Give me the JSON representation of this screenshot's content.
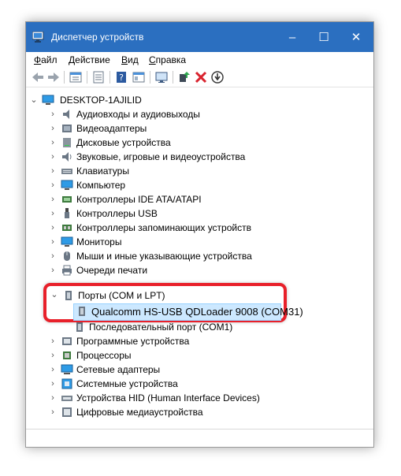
{
  "window": {
    "title": "Диспетчер устройств",
    "controls": {
      "minimize": "–",
      "maximize": "☐",
      "close": "✕"
    },
    "accent": "#2b6fc0"
  },
  "menu": [
    {
      "label": "Файл",
      "mnemonic": "Ф",
      "rest": "айл"
    },
    {
      "label": "Действие",
      "mnemonic": "Д",
      "rest": "ействие"
    },
    {
      "label": "Вид",
      "mnemonic": "В",
      "rest": "ид"
    },
    {
      "label": "Справка",
      "mnemonic": "С",
      "rest": "правка"
    }
  ],
  "toolbar": [
    "back-icon",
    "forward-icon",
    "properties-list-icon",
    "properties-icon",
    "help-icon",
    "view-icon",
    "monitor-scan-icon",
    "update-driver-icon",
    "uninstall-icon",
    "download-icon"
  ],
  "tree": {
    "root": "DESKTOP-1AJILID",
    "items": [
      {
        "label": "Аудиовходы и аудиовыходы",
        "icon": "audio-icon"
      },
      {
        "label": "Видеоадаптеры",
        "icon": "display-adapter-icon"
      },
      {
        "label": "Дисковые устройства",
        "icon": "disk-icon"
      },
      {
        "label": "Звуковые, игровые и видеоустройства",
        "icon": "sound-icon"
      },
      {
        "label": "Клавиатуры",
        "icon": "keyboard-icon"
      },
      {
        "label": "Компьютер",
        "icon": "computer-icon"
      },
      {
        "label": "Контроллеры IDE ATA/ATAPI",
        "icon": "ide-controller-icon"
      },
      {
        "label": "Контроллеры USB",
        "icon": "usb-icon"
      },
      {
        "label": "Контроллеры запоминающих устройств",
        "icon": "storage-controller-icon"
      },
      {
        "label": "Мониторы",
        "icon": "monitor-icon"
      },
      {
        "label": "Мыши и иные указывающие устройства",
        "icon": "mouse-icon"
      },
      {
        "label": "Очереди печати",
        "icon": "printer-icon"
      },
      {
        "label": "Программные устройства",
        "icon": "software-device-icon"
      },
      {
        "label": "Процессоры",
        "icon": "processor-icon"
      },
      {
        "label": "Сетевые адаптеры",
        "icon": "network-adapter-icon"
      },
      {
        "label": "Системные устройства",
        "icon": "system-device-icon"
      },
      {
        "label": "Устройства HID (Human Interface Devices)",
        "icon": "hid-icon"
      },
      {
        "label": "Цифровые медиаустройства",
        "icon": "media-device-icon"
      }
    ],
    "ports": {
      "label": "Порты (COM и LPT)",
      "children": [
        "Qualcomm HS-USB QDLoader 9008 (COM31)",
        "Последовательный порт (COM1)"
      ]
    }
  }
}
